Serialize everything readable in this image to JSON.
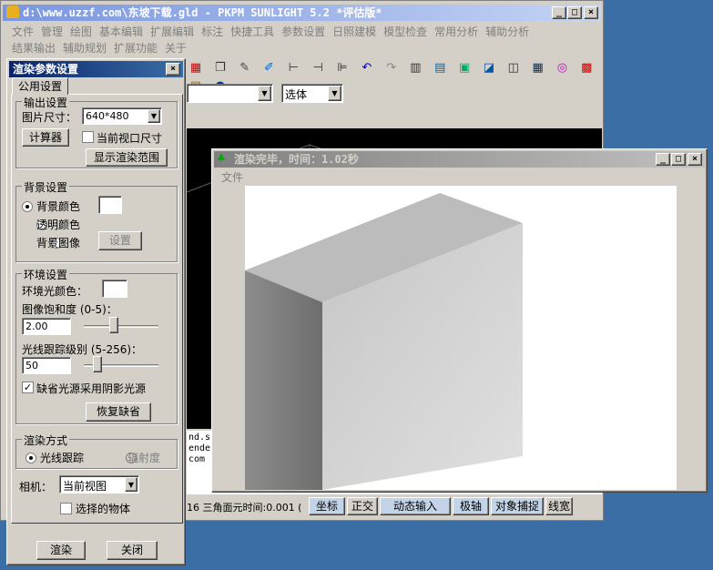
{
  "main_window": {
    "title": "d:\\www.uzzf.com\\东坡下载.gld - PKPM SUNLIGHT 5.2 *评估版*",
    "menu_row1": [
      "文件",
      "管理",
      "绘图",
      "基本编辑",
      "扩展编辑",
      "标注",
      "快捷工具",
      "参数设置",
      "日照建模",
      "模型检查",
      "常用分析",
      "辅助分析"
    ],
    "menu_row2": [
      "结果输出",
      "辅助规划",
      "扩展功能",
      "关于"
    ],
    "select_value": "选体"
  },
  "console_lines": [
    "nd.sc",
    "ender",
    "com"
  ],
  "status_bar": {
    "left_text": "16  三角面元时间:0.001 (",
    "buttons": [
      "坐标",
      "正交",
      "动态输入",
      "极轴",
      "对象捕捉",
      "线宽"
    ]
  },
  "dialog": {
    "title": "渲染参数设置",
    "tab": "公用设置",
    "output": {
      "group": "输出设置",
      "size_label": "图片尺寸：",
      "size_value": "640*480",
      "calc_button": "计算器",
      "viewport_checkbox": "当前视口尺寸",
      "show_range_button": "显示渲染范围"
    },
    "background": {
      "group": "背景设置",
      "opt_color": "背景颜色",
      "opt_transparent": "透明颜色",
      "opt_image": "背景图像",
      "settings_button": "设置"
    },
    "environment": {
      "group": "环境设置",
      "ambient_label": "环境光颜色：",
      "saturation_label": "图像饱和度 (0-5)：",
      "saturation_value": "2.00",
      "saturation_level": 0.4,
      "raytrace_label": "光线跟踪级别 (5-256)：",
      "raytrace_value": "50",
      "raytrace_level": 0.18,
      "shadow_checkbox": "缺省光源采用阴影光源",
      "restore_button": "恢复缺省"
    },
    "render_mode": {
      "group": "渲染方式",
      "opt_raytrace": "光线跟踪",
      "opt_radiosity": "辐射度"
    },
    "camera_label": "相机：",
    "camera_value": "当前视图",
    "selected_checkbox": "选择的物体",
    "render_button": "渲染",
    "close_button": "关闭"
  },
  "render_window": {
    "title": "渲染完毕，时间：1.02秒",
    "menu": "文件"
  },
  "colors": {
    "desktop": "#3a6ea5",
    "face": "#d4d0c8",
    "active_title": "#0a246a"
  }
}
